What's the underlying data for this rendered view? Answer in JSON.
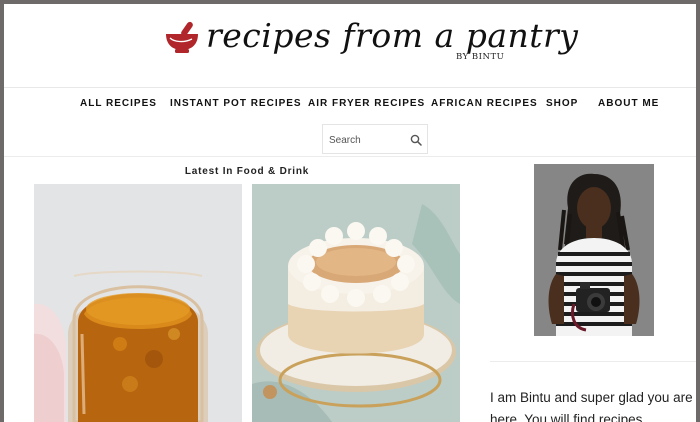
{
  "brand": {
    "name": "recipes from a pantry",
    "byline": "BY BINTU",
    "accent_color": "#b0262a"
  },
  "nav": {
    "items": [
      {
        "label": "ALL RECIPES"
      },
      {
        "label": "INSTANT POT RECIPES"
      },
      {
        "label": "AIR FRYER RECIPES"
      },
      {
        "label": "AFRICAN RECIPES"
      },
      {
        "label": "SHOP"
      },
      {
        "label": "ABOUT ME"
      }
    ]
  },
  "search": {
    "placeholder": "Search",
    "icon": "search-icon"
  },
  "main": {
    "section_title": "Latest In Food & Drink",
    "cards": [
      {
        "image": "marmalade-jar-photo"
      },
      {
        "image": "coconut-cake-photo"
      }
    ]
  },
  "sidebar": {
    "photo": "author-portrait-photo",
    "intro": "I am Bintu and super glad you are",
    "intro_line2": "here. You will find recipes"
  }
}
